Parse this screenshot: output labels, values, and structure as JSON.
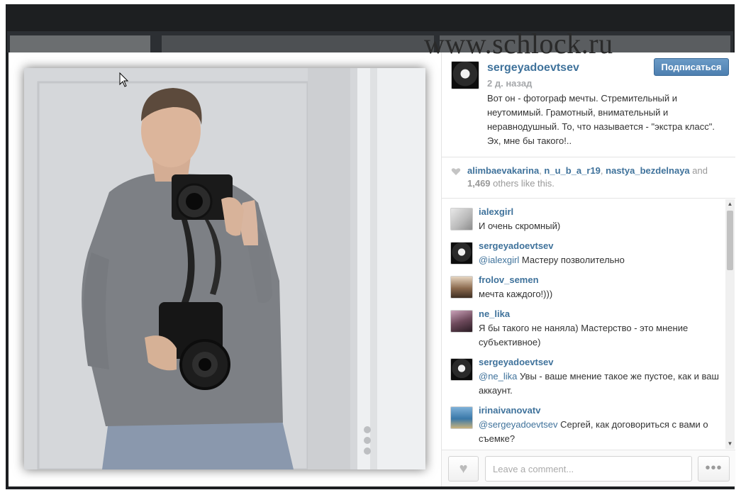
{
  "watermark": "www.schlock.ru",
  "post": {
    "author": "sergeyadoevtsev",
    "time": "2 д. назад",
    "caption": "Вот он - фотограф мечты. Стремительный и неутомимый. Грамотный, внимательный и неравнодушный. То, что называется - \"экстра класс\". Эх, мне бы такого!..",
    "follow_label": "Подписаться"
  },
  "likes": {
    "users": [
      "alimbaevakarina",
      "n_u_b_a_r19",
      "nastya_bezdelnaya"
    ],
    "and": "and",
    "count": "1,469",
    "suffix": "others like this."
  },
  "comments": [
    {
      "user": "ialexgirl",
      "mention": "",
      "text": "И очень скромный)"
    },
    {
      "user": "sergeyadoevtsev",
      "mention": "@ialexgirl",
      "text": " Мастеру позволительно"
    },
    {
      "user": "frolov_semen",
      "mention": "",
      "text": "мечта каждого!)))"
    },
    {
      "user": "ne_lika",
      "mention": "",
      "text": "Я бы такого не наняла) Мастерство - это мнение субъективное)"
    },
    {
      "user": "sergeyadoevtsev",
      "mention": "@ne_lika",
      "text": " Увы - ваше мнение такое же пустое, как и ваш аккаунт."
    },
    {
      "user": "irinaivanovatv",
      "mention": "@sergeyadoevtsev",
      "text": " Сергей, как договориться с вами о съемке?"
    }
  ],
  "footer": {
    "comment_placeholder": "Leave a comment...",
    "more_label": "•••"
  },
  "icons": {
    "like": "heart-icon",
    "more": "ellipsis-icon",
    "cursor": "cursor-icon"
  }
}
